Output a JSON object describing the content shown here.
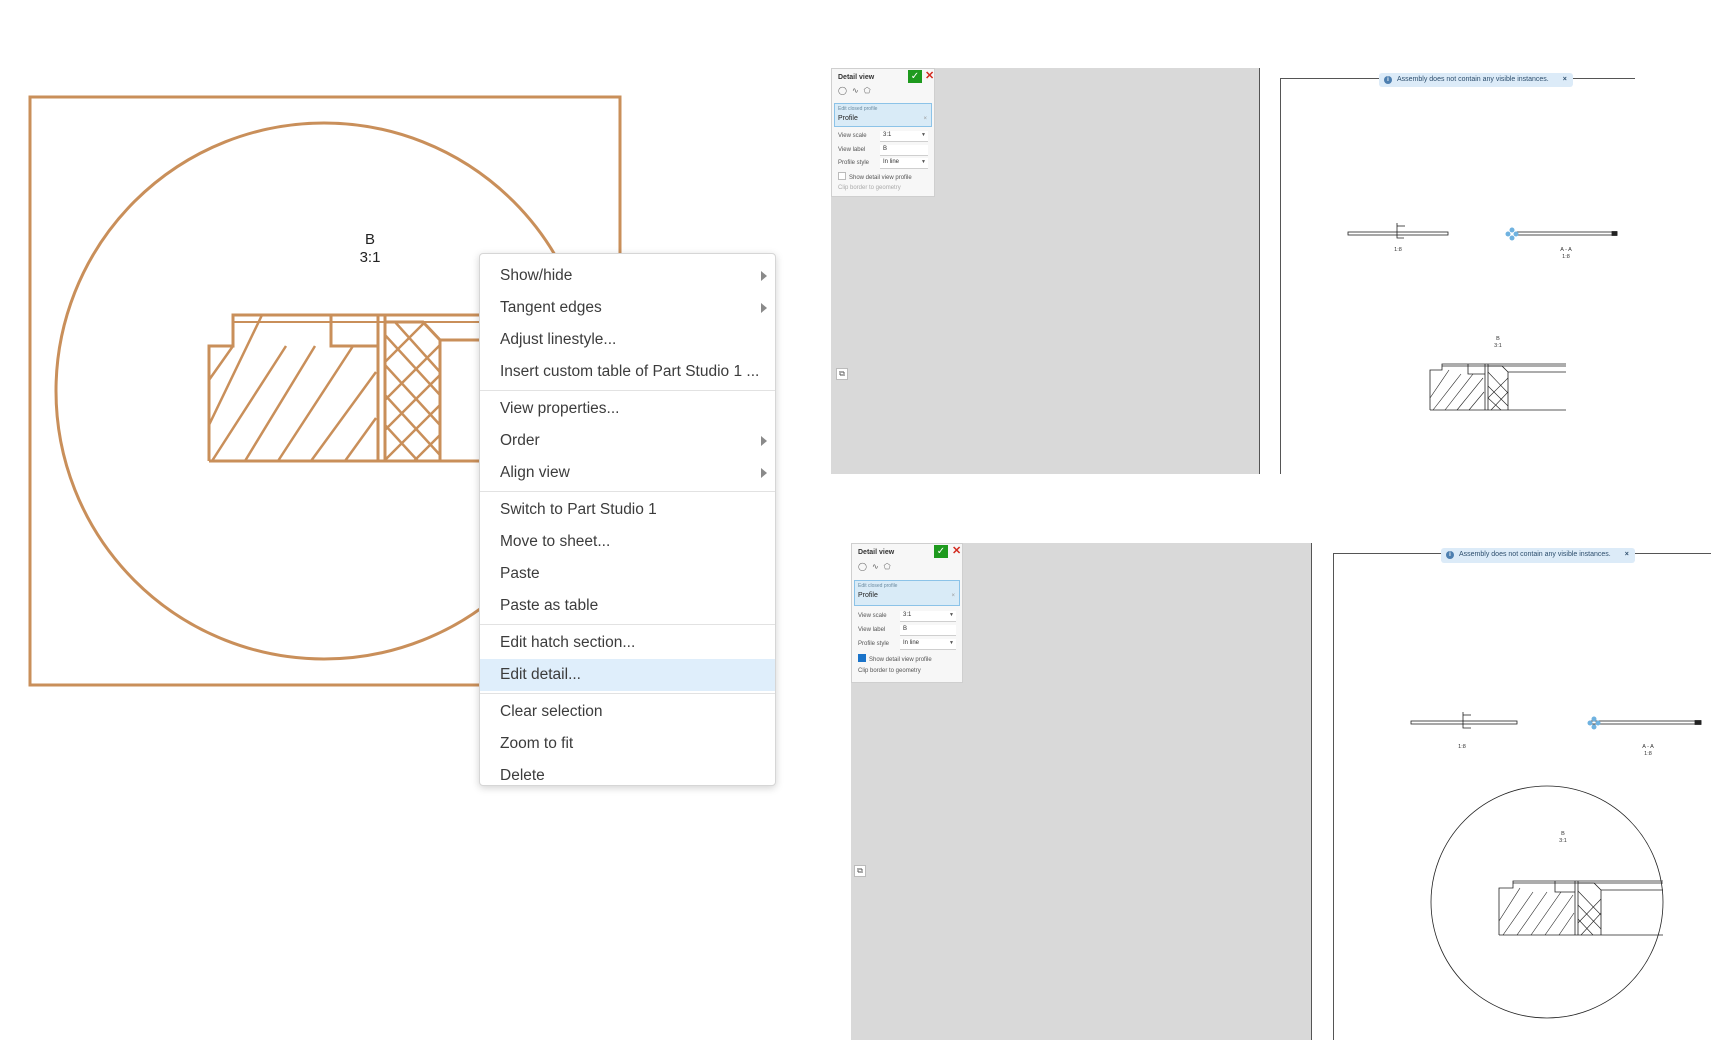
{
  "detail_view": {
    "label_letter": "B",
    "label_scale": "3:1",
    "colors": {
      "stroke": "#c98f5a"
    }
  },
  "context_menu": {
    "items": [
      {
        "label": "Show/hide",
        "submenu": true
      },
      {
        "label": "Tangent edges",
        "submenu": true
      },
      {
        "label": "Adjust linestyle...",
        "submenu": false
      },
      {
        "label": "Insert custom table of Part Studio 1 ...",
        "submenu": false
      },
      {
        "label": "View properties...",
        "submenu": false
      },
      {
        "label": "Order",
        "submenu": true
      },
      {
        "label": "Align view",
        "submenu": true
      },
      {
        "label": "Switch to Part Studio 1",
        "submenu": false
      },
      {
        "label": "Move to sheet...",
        "submenu": false
      },
      {
        "label": "Paste",
        "submenu": false
      },
      {
        "label": "Paste as table",
        "submenu": false
      },
      {
        "label": "Edit hatch section...",
        "submenu": false
      },
      {
        "label": "Edit detail...",
        "submenu": false,
        "highlighted": true
      },
      {
        "label": "Clear selection",
        "submenu": false
      },
      {
        "label": "Zoom to fit",
        "submenu": false
      },
      {
        "label": "Delete",
        "submenu": false
      }
    ]
  },
  "screenshot_top": {
    "panel": {
      "title": "Detail view",
      "confirm_icon": "check-icon",
      "cancel_icon": "close-icon",
      "toolbar_icons": [
        "circle-icon",
        "spline-icon",
        "polygon-icon"
      ],
      "profile_hint": "Edit closed profile",
      "profile_value": "Profile",
      "view_scale_label": "View scale",
      "view_scale_value": "3:1",
      "view_label_label": "View label",
      "view_label_value": "B",
      "profile_style_label": "Profile style",
      "profile_style_value": "In line",
      "show_profile_label": "Show detail view profile",
      "show_profile_checked": false,
      "clip_border_label": "Clip border to geometry"
    },
    "notice": "Assembly does not contain any visible instances.",
    "view1_scale": "1:8",
    "view2_label": "A - A",
    "view2_scale": "1:8",
    "detail_label": "B",
    "detail_scale": "3:1"
  },
  "screenshot_bottom": {
    "panel": {
      "title": "Detail view",
      "confirm_icon": "check-icon",
      "cancel_icon": "close-icon",
      "toolbar_icons": [
        "circle-icon",
        "spline-icon",
        "polygon-icon"
      ],
      "profile_hint": "Edit closed profile",
      "profile_value": "Profile",
      "view_scale_label": "View scale",
      "view_scale_value": "3:1",
      "view_label_label": "View label",
      "view_label_value": "B",
      "profile_style_label": "Profile style",
      "profile_style_value": "In line",
      "show_profile_label": "Show detail view profile",
      "show_profile_checked": true,
      "clip_border_label": "Clip border to geometry"
    },
    "notice": "Assembly does not contain any visible instances.",
    "view1_scale": "1:8",
    "view2_label": "A - A",
    "view2_scale": "1:8",
    "detail_label": "B",
    "detail_scale": "3:1"
  }
}
